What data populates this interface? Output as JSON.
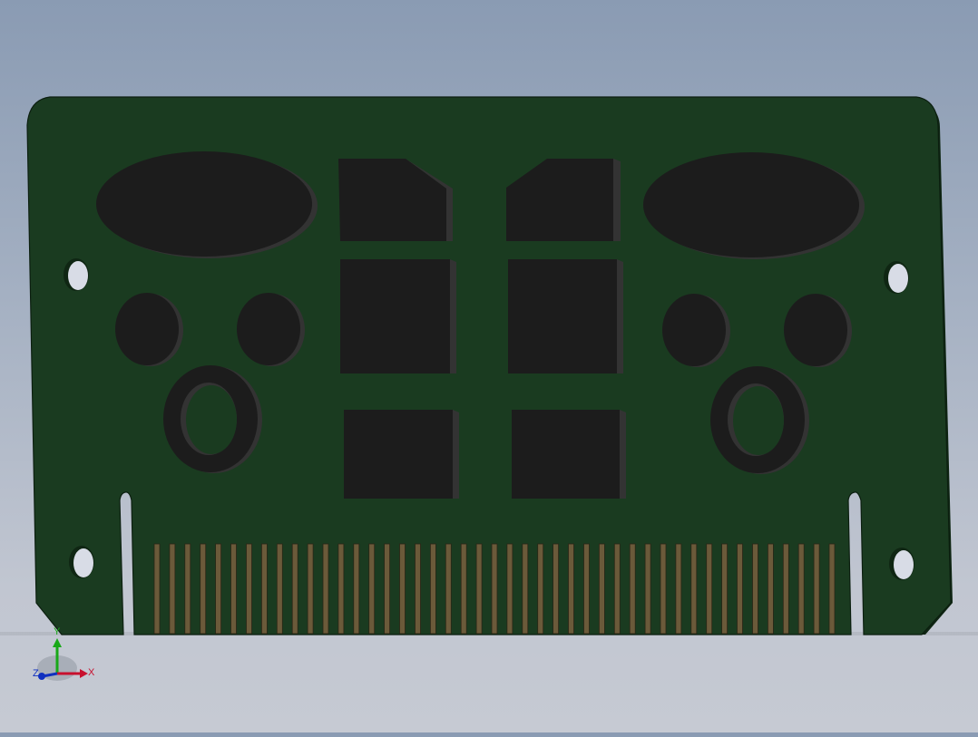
{
  "viewport": {
    "background_top": "#8a9bb3",
    "background_bottom": "#c6cad3"
  },
  "model": {
    "board_color": "#1a3b20",
    "board_edge_color": "#0f2613",
    "component_color": "#1c1c1c",
    "component_side_color": "#333333",
    "contact_color": "#6b5a3a",
    "components": {
      "ovals": 2,
      "upper_chips": 2,
      "middle_chips": 2,
      "lower_chips": 2,
      "round_pads": 4,
      "rings": 2,
      "mounting_holes": 4,
      "edge_contacts": 45
    }
  },
  "triad": {
    "x_label": "X",
    "y_label": "Y",
    "z_label": "Z",
    "x_color": "#c8102e",
    "y_color": "#18a818",
    "z_color": "#1030c0"
  }
}
